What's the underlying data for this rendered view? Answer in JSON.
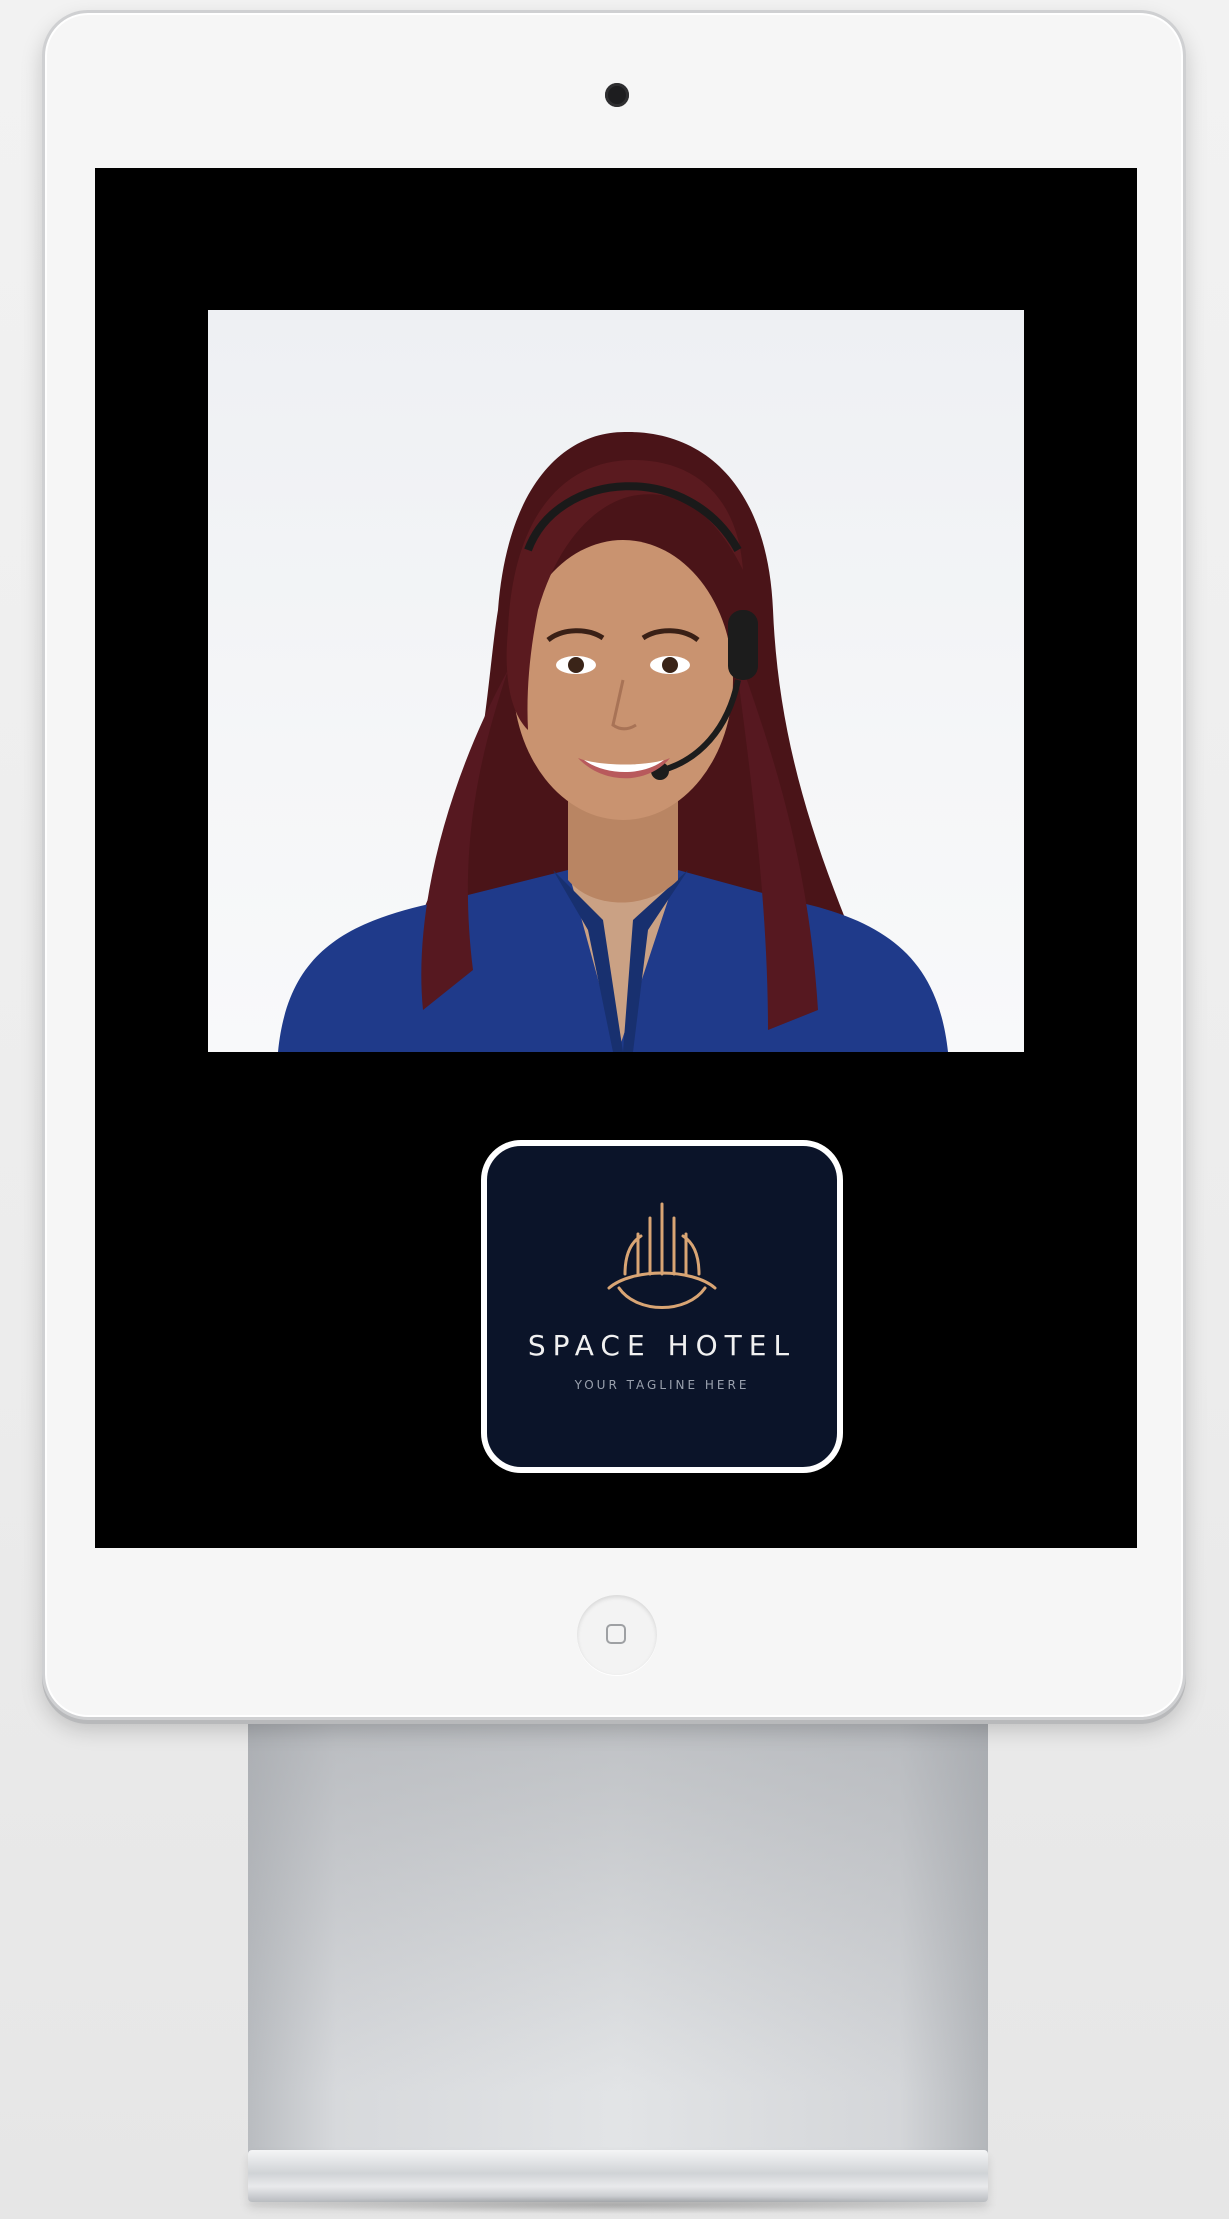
{
  "kiosk": {
    "brand_name": "SPACE HOTEL",
    "tagline": "YOUR TAGLINE HERE"
  },
  "colors": {
    "screen_background": "#000000",
    "logo_background": "#0b1429",
    "logo_gold": "#d9a574",
    "agent_shirt": "#1f3a8a"
  },
  "icons": {
    "emblem": "hotel-building-emblem-icon",
    "home": "home-button-icon"
  }
}
